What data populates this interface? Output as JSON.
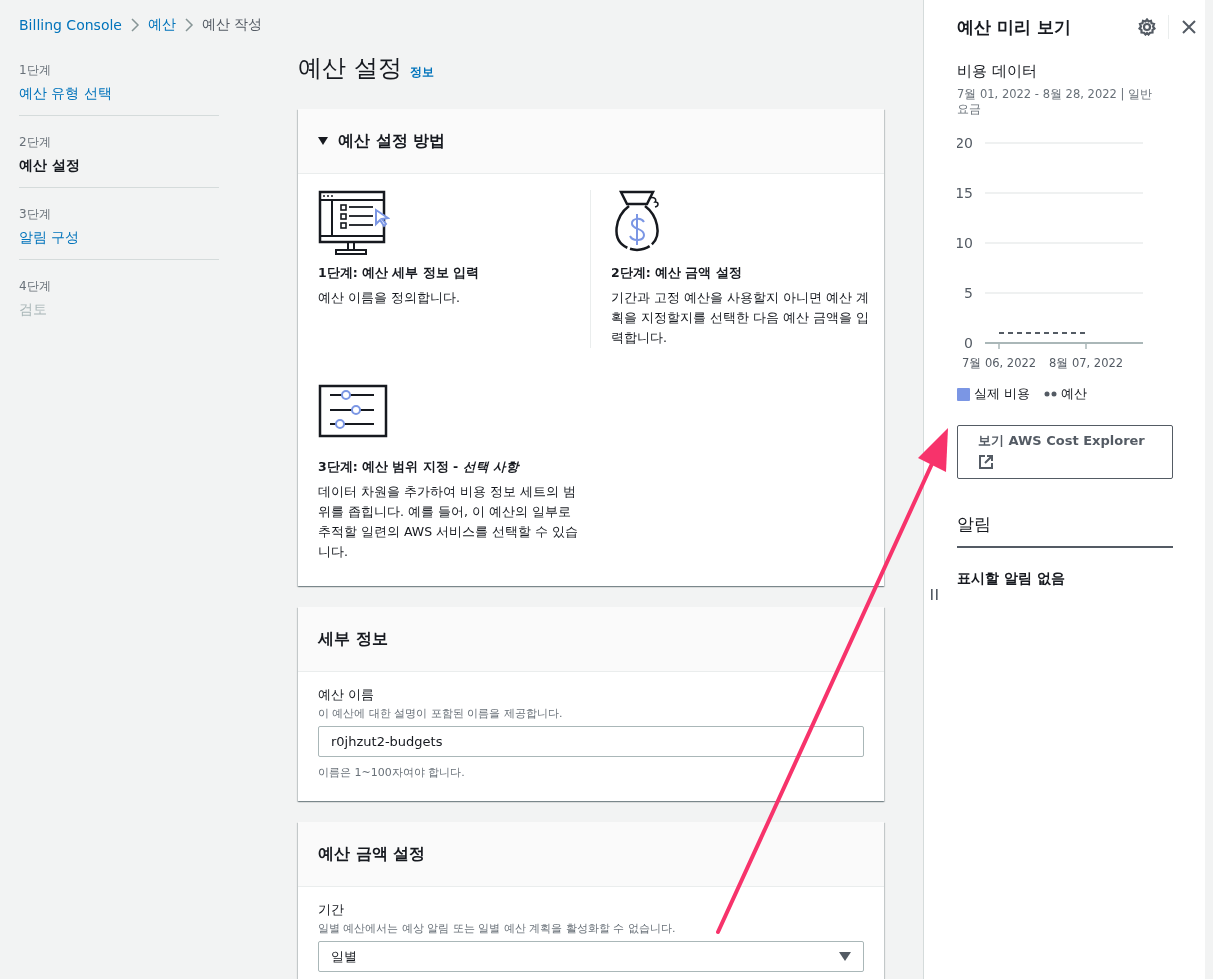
{
  "breadcrumb": [
    {
      "label": "Billing Console",
      "current": false
    },
    {
      "label": "예산",
      "current": false
    },
    {
      "label": "예산 작성",
      "current": true
    }
  ],
  "steps": [
    {
      "step": "1단계",
      "title": "예산 유형 선택",
      "selected": false,
      "disabled": false
    },
    {
      "step": "2단계",
      "title": "예산 설정",
      "selected": true,
      "disabled": false
    },
    {
      "step": "3단계",
      "title": "알림 구성",
      "selected": false,
      "disabled": false
    },
    {
      "step": "4단계",
      "title": "검토",
      "selected": false,
      "disabled": true
    }
  ],
  "page": {
    "title": "예산 설정",
    "info_link": "정보"
  },
  "how_to": {
    "title": "예산 설정 방법",
    "expanded": true,
    "items": [
      {
        "title": "1단계: 예산 세부 정보 입력",
        "text": "예산 이름을 정의합니다."
      },
      {
        "title": "2단계: 예산 금액 설정",
        "text": "기간과 고정 예산을 사용할지 아니면 예산 계획을 지정할지를 선택한 다음 예산 금액을 입력합니다."
      },
      {
        "title": "3단계: 예산 범위 지정 - *선택 사항*",
        "text": "데이터 차원을 추가하여 비용 정보 세트의 범위를 좁힙니다. 예를 들어, 이 예산의 일부로 추적할 일련의 AWS 서비스를 선택할 수 있습니다."
      }
    ]
  },
  "details": {
    "title": "세부 정보",
    "field": {
      "label": "예산 이름",
      "description": "이 예산에 대한 설명이 포함된 이름을 제공합니다.",
      "value": "r0jhzut2-budgets",
      "constraint": "이름은 1~100자여야 합니다."
    }
  },
  "amount": {
    "title": "예산 금액 설정",
    "field": {
      "label": "기간",
      "description": "일별 예산에서는 예상 알림 또는 일별 예산 계획을 활성화할 수 없습니다.",
      "value": "일별"
    }
  },
  "preview": {
    "title": "예산 미리 보기",
    "cost_data": {
      "title": "비용 데이터",
      "subtitle": "7월 01, 2022 - 8월 28, 2022 | 일반 요금",
      "chart_data": {
        "type": "line",
        "categories": [
          "7월 06, 2022",
          "8월 07, 2022"
        ],
        "ylim": [
          0,
          20
        ],
        "yticks": [
          0,
          5,
          10,
          15,
          20
        ],
        "grid": true,
        "series": [
          {
            "name": "실제 비용",
            "color": "#7b96e4",
            "values": [
              null,
              null
            ],
            "line_style": "solid"
          },
          {
            "name": "예산",
            "color": "#545b64",
            "values": [
              1,
              1
            ],
            "line_style": "dashed"
          }
        ]
      }
    },
    "explorer_button": "보기 AWS Cost Explorer",
    "alerts": {
      "title": "알림",
      "empty": "표시할 알림 없음"
    }
  }
}
